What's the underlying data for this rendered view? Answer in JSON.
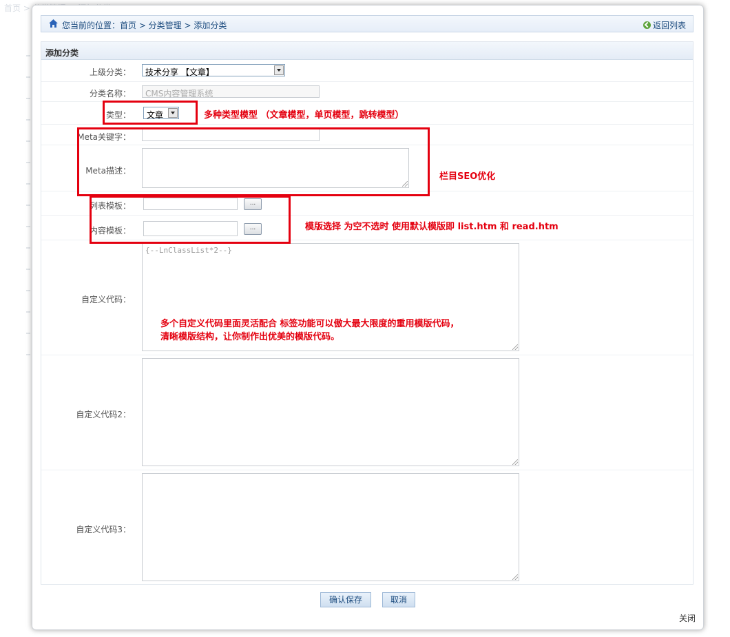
{
  "background": {
    "crumb": "首页 > 分类管理 > 添加分类"
  },
  "breadcrumb": {
    "prefix": "您当前的位置：",
    "items": [
      "首页",
      "分类管理",
      "添加分类"
    ],
    "text": "您当前的位置：首页 > 分类管理 > 添加分类",
    "back_label": "返回列表"
  },
  "form": {
    "title": "添加分类",
    "parent": {
      "label": "上级分类：",
      "value": "技术分享 【文章】"
    },
    "name": {
      "label": "分类名称：",
      "placeholder": "CMS内容管理系统"
    },
    "type": {
      "label": "类型：",
      "value": "文章"
    },
    "meta_keywords": {
      "label": "Meta关键字：",
      "value": ""
    },
    "meta_desc": {
      "label": "Meta描述：",
      "value": ""
    },
    "list_tpl": {
      "label": "列表模板：",
      "value": "",
      "btn": "..."
    },
    "content_tpl": {
      "label": "内容模板：",
      "value": "",
      "btn": "..."
    },
    "custom1": {
      "label": "自定义代码：",
      "value": "{--LnClassList*2--}"
    },
    "custom2": {
      "label": "自定义代码2：",
      "value": ""
    },
    "custom3": {
      "label": "自定义代码3：",
      "value": ""
    }
  },
  "annotations": {
    "type_note": "多种类型模型 （文章模型，单页模型，跳转模型）",
    "seo_note": "栏目SEO优化",
    "tpl_note": "模版选择 为空不选时 使用默认模版即 list.htm  和 read.htm",
    "custom_note_line1": "多个自定义代码里面灵活配合 标签功能可以傲大最大限度的重用模版代码，",
    "custom_note_line2": "清晰模版结构，让你制作出优美的模版代码。"
  },
  "buttons": {
    "save": "确认保存",
    "cancel": "取消",
    "close": "关闭"
  },
  "colors": {
    "annotation": "#e4000f",
    "link": "#1d4c7f"
  }
}
